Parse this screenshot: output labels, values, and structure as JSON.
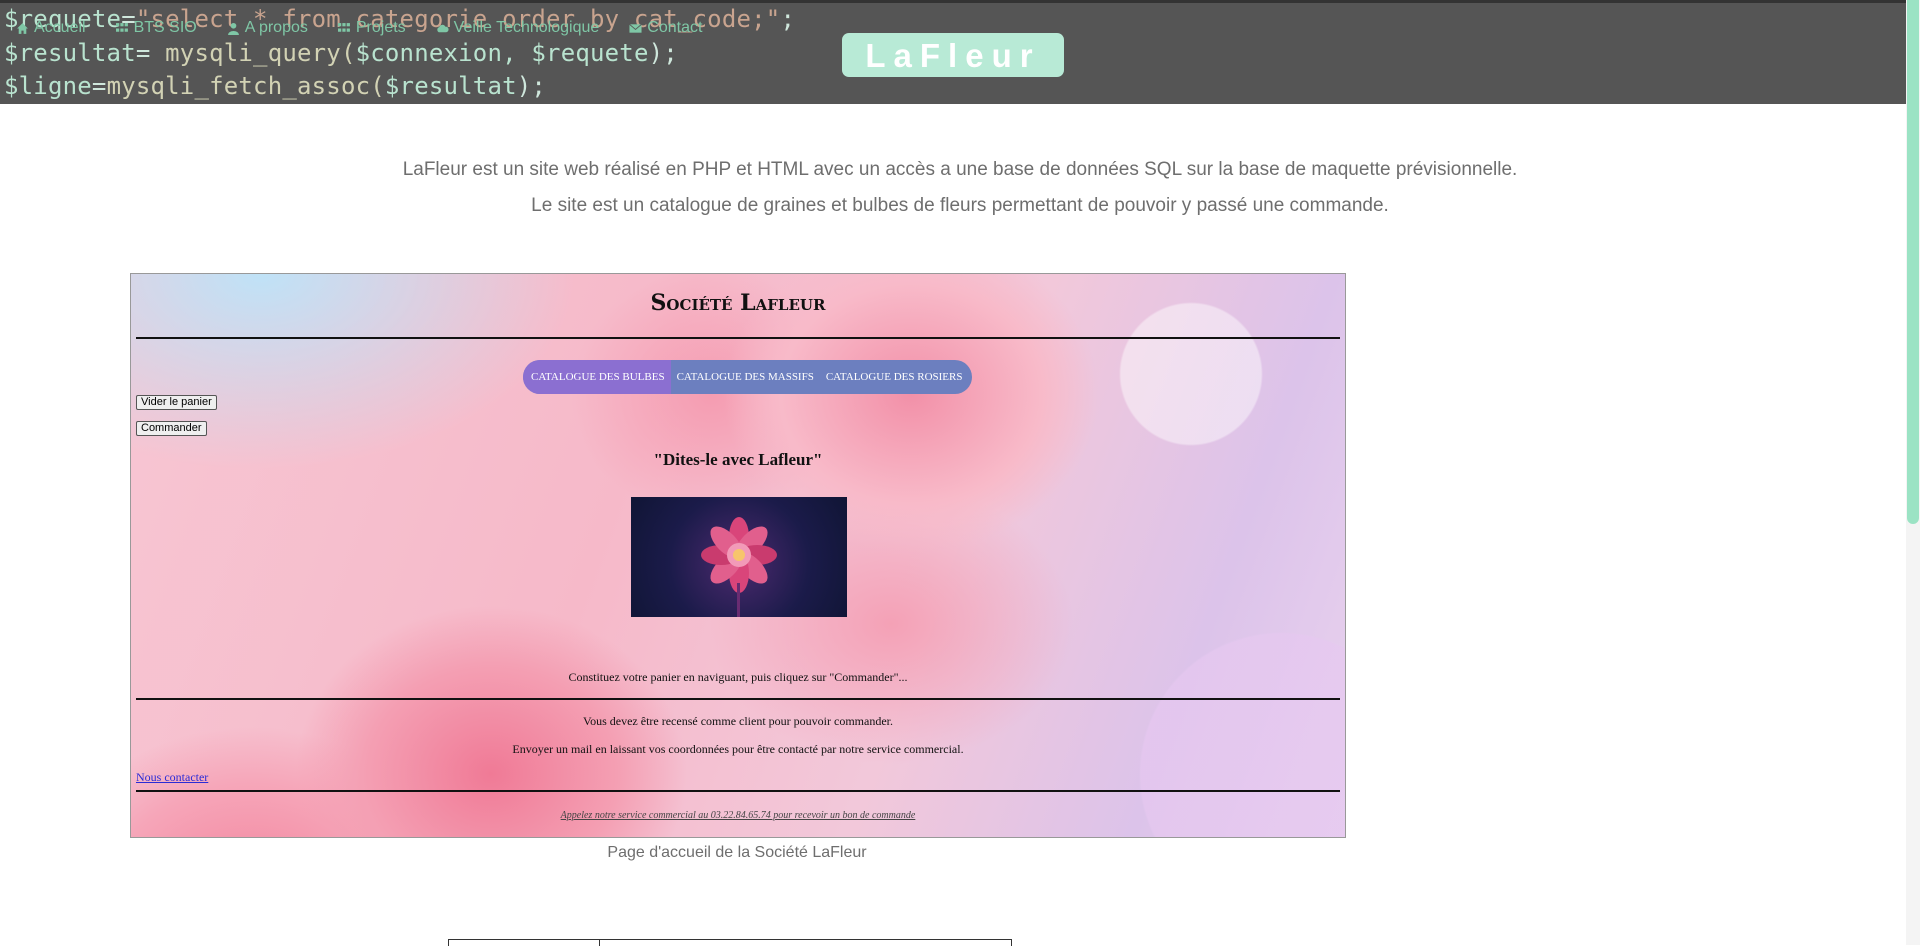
{
  "header": {
    "code_lines": [
      {
        "var": "$requete",
        "op": "=",
        "str": "\"select * from categorie order by cat_code;\"",
        "end": ";"
      },
      {
        "var": "$resultat",
        "op": "= ",
        "fn": "mysqli_query(",
        "args": "$connexion, $requete",
        "end": ");"
      },
      {
        "var": "$ligne",
        "op": "=",
        "fn": "mysqli_fetch_assoc(",
        "args": "$resultat",
        "end": ");"
      }
    ],
    "nav": [
      {
        "label": "Accueil",
        "icon": "home-icon"
      },
      {
        "label": "BTS SIO",
        "icon": "grid-icon"
      },
      {
        "label": "A propos",
        "icon": "user-icon"
      },
      {
        "label": "Projets",
        "icon": "grid-icon"
      },
      {
        "label": "Veille Technologique",
        "icon": "cloud-icon"
      },
      {
        "label": "Contact",
        "icon": "envelope-icon"
      }
    ],
    "brand": "LaFleur",
    "accent_color": "#7fc7a6"
  },
  "intro": {
    "line1": "LaFleur est un site web réalisé en PHP et HTML avec un accès a une base de données SQL sur la base de maquette prévisionnelle.",
    "line2": "Le site est un catalogue de graines et bulbes de fleurs permettant de pouvoir y passé une commande."
  },
  "screenshot": {
    "title": "Société Lafleur",
    "menu": [
      "CATALOGUE DES BULBES",
      "CATALOGUE DES MASSIFS",
      "CATALOGUE DES ROSIERS"
    ],
    "btn_empty": "Vider le panier",
    "btn_order": "Commander",
    "slogan": "\"Dites-le avec Lafleur\"",
    "basket_text": "Constituez votre panier en naviguant, puis cliquez sur \"Commander\"...",
    "client_text": "Vous devez être recensé comme client pour pouvoir commander.",
    "mail_text": "Envoyer un mail en laissant vos coordonnées pour être contacté par notre service commercial.",
    "contact_link": "Nous contacter",
    "phone_text": "Appelez notre service commercial au 03.22.84.65.74 pour recevoir un bon de commande"
  },
  "caption": "Page d'accueil de la Société LaFleur"
}
